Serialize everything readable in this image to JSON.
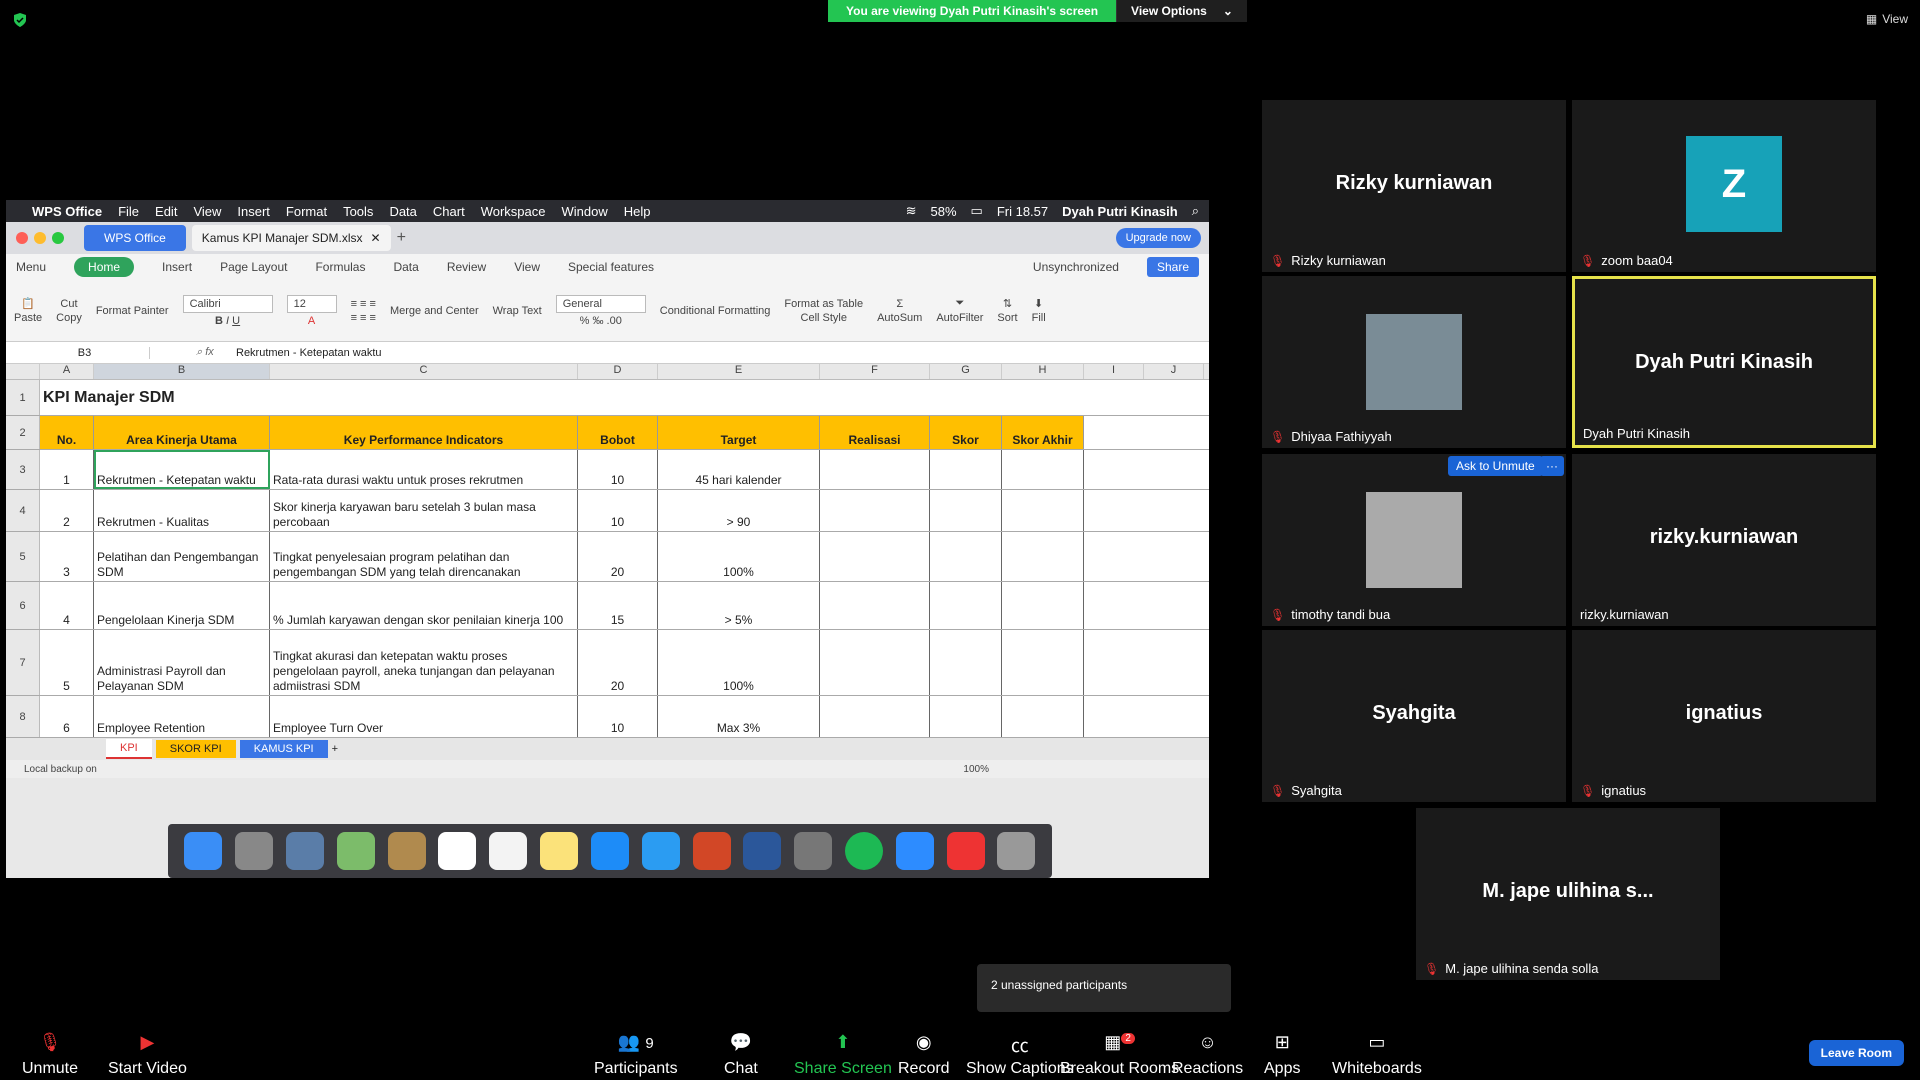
{
  "banner": {
    "viewing": "You are viewing Dyah Putri Kinasih's screen",
    "options": "View Options"
  },
  "view_btn": "View",
  "mac": {
    "app": "WPS Office",
    "menus": [
      "File",
      "Edit",
      "View",
      "Insert",
      "Format",
      "Tools",
      "Data",
      "Chart",
      "Workspace",
      "Window",
      "Help"
    ],
    "battery": "58%",
    "time": "Fri 18.57",
    "user": "Dyah Putri Kinasih"
  },
  "wps": {
    "tab_main": "WPS Office",
    "tab_file": "Kamus KPI Manajer SDM.xlsx",
    "upgrade": "Upgrade now",
    "menu": "Menu",
    "ribbon_tabs": [
      "Home",
      "Insert",
      "Page Layout",
      "Formulas",
      "Data",
      "Review",
      "View",
      "Special features"
    ],
    "unsync": "Unsynchronized",
    "share": "Share",
    "font": "Calibri",
    "size": "12",
    "numfmt": "General",
    "ribbon_labels": [
      "Paste",
      "Cut",
      "Copy",
      "Format Painter",
      "Merge and Center",
      "Wrap Text",
      "Conditional Formatting",
      "Format as Table",
      "Cell Style",
      "AutoSum",
      "AutoFilter",
      "Sort",
      "Fill"
    ],
    "namebox": "B3",
    "formula": "Rekrutmen - Ketepatan waktu"
  },
  "sheet": {
    "cols": [
      "A",
      "B",
      "C",
      "D",
      "E",
      "F",
      "G",
      "H",
      "I",
      "J"
    ],
    "title": "KPI Manajer SDM",
    "headers": [
      "No.",
      "Area Kinerja Utama",
      "Key Performance Indicators",
      "Bobot",
      "Target",
      "Realisasi",
      "Skor",
      "Skor Akhir"
    ],
    "rows": [
      {
        "n": "3",
        "no": "1",
        "area": "Rekrutmen - Ketepatan waktu",
        "kpi": "Rata-rata durasi waktu untuk proses rekrutmen",
        "bobot": "10",
        "target": "45 hari kalender"
      },
      {
        "n": "4",
        "no": "2",
        "area": "Rekrutmen - Kualitas",
        "kpi": "Skor kinerja karyawan baru setelah 3 bulan masa percobaan",
        "bobot": "10",
        "target": "> 90"
      },
      {
        "n": "5",
        "no": "3",
        "area": "Pelatihan dan Pengembangan SDM",
        "kpi": "Tingkat penyelesaian program pelatihan dan pengembangan SDM yang telah direncanakan",
        "bobot": "20",
        "target": "100%"
      },
      {
        "n": "6",
        "no": "4",
        "area": "Pengelolaan Kinerja SDM",
        "kpi": "% Jumlah karyawan dengan skor penilaian kinerja 100",
        "bobot": "15",
        "target": "> 5%"
      },
      {
        "n": "7",
        "no": "5",
        "area": "Administrasi Payroll dan Pelayanan SDM",
        "kpi": "Tingkat akurasi dan ketepatan waktu proses pengelolaan payroll, aneka tunjangan dan pelayanan admiistrasi SDM",
        "bobot": "20",
        "target": "100%"
      },
      {
        "n": "8",
        "no": "6",
        "area": "Employee Retention",
        "kpi": "Employee Turn Over",
        "bobot": "10",
        "target": "Max 3%"
      }
    ],
    "tabs": [
      "KPI",
      "SKOR KPI",
      "KAMUS KPI"
    ],
    "backup": "Local backup on",
    "zoom": "100%"
  },
  "participants": [
    {
      "big": "Rizky kurniawan",
      "label": "Rizky kurniawan",
      "muted": true
    },
    {
      "big": "Z",
      "label": "zoom baa04",
      "muted": true
    },
    {
      "big": "",
      "label": "Dhiyaa Fathiyyah",
      "muted": true
    },
    {
      "big": "Dyah Putri Kinasih",
      "label": "Dyah Putri Kinasih",
      "muted": false
    },
    {
      "big": "",
      "label": "timothy tandi bua",
      "muted": true
    },
    {
      "big": "rizky.kurniawan",
      "label": "rizky.kurniawan",
      "muted": false
    },
    {
      "big": "Syahgita",
      "label": "Syahgita",
      "muted": true
    },
    {
      "big": "ignatius",
      "label": "ignatius",
      "muted": true
    },
    {
      "big": "M. jape ulihina s...",
      "label": "M. jape ulihina senda solla",
      "muted": true
    }
  ],
  "ask_unmute": "Ask to Unmute",
  "unassigned": "2 unassigned participants",
  "toolbar": {
    "unmute": "Unmute",
    "video": "Start Video",
    "participants": "Participants",
    "participants_count": "9",
    "chat": "Chat",
    "share": "Share Screen",
    "record": "Record",
    "captions": "Show Captions",
    "breakout": "Breakout Rooms",
    "breakout_badge": "2",
    "reactions": "Reactions",
    "apps": "Apps",
    "whiteboards": "Whiteboards",
    "leave": "Leave Room"
  },
  "colors": {
    "header": "#ffbf00",
    "accent_green": "#23c552",
    "zoom_blue": "#1a64d6",
    "active_border": "#e6e24a"
  }
}
